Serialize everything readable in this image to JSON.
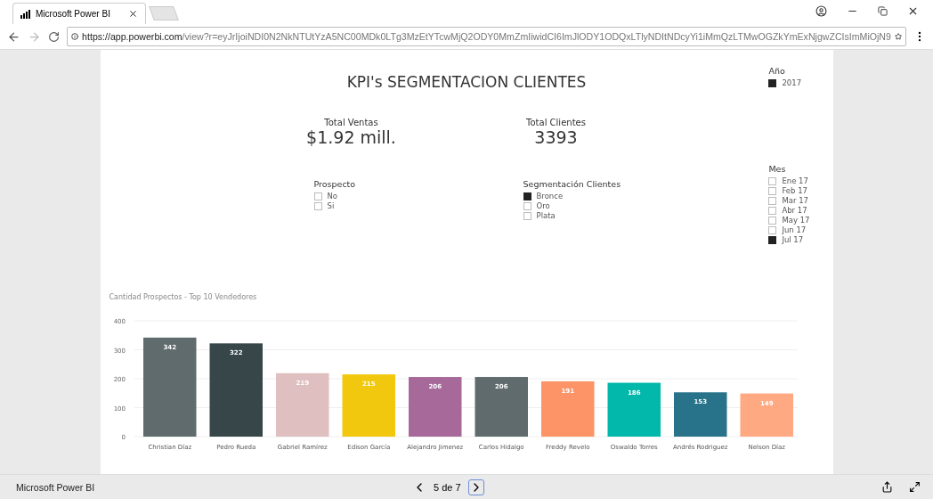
{
  "browser": {
    "tab_title": "Microsoft Power BI",
    "url_host": "https://app.powerbi.com",
    "url_path": "/view?r=eyJrIjoiNDI0N2NkNTUtYzA5NC00MDk0LTg3MzEtYTcwMjQ2ODY0MmZmIiwidCI6ImJlODY1ODQxLTlyNDItNDcyYi1iMmQzLTMwOGZkYmExNjgwZCIsImMiOjN9"
  },
  "report": {
    "title": "KPI's SEGMENTACION CLIENTES",
    "kpis": [
      {
        "label": "Total Ventas",
        "value": "$1.92 mill."
      },
      {
        "label": "Total Clientes",
        "value": "3393"
      }
    ],
    "slicers": [
      {
        "title": "Prospecto",
        "items": [
          {
            "label": "No",
            "checked": false
          },
          {
            "label": "Si",
            "checked": false
          }
        ]
      },
      {
        "title": "Segmentación Clientes",
        "items": [
          {
            "label": "Bronce",
            "checked": true
          },
          {
            "label": "Oro",
            "checked": false
          },
          {
            "label": "Plata",
            "checked": false
          }
        ]
      }
    ],
    "year_slicer": {
      "title": "Año",
      "items": [
        {
          "label": "2017",
          "checked": true
        }
      ]
    },
    "month_slicer": {
      "title": "Mes",
      "items": [
        {
          "label": "Ene 17",
          "checked": false
        },
        {
          "label": "Feb 17",
          "checked": false
        },
        {
          "label": "Mar 17",
          "checked": false
        },
        {
          "label": "Abr 17",
          "checked": false
        },
        {
          "label": "May 17",
          "checked": false
        },
        {
          "label": "Jun 17",
          "checked": false
        },
        {
          "label": "Jul 17",
          "checked": true
        }
      ]
    },
    "chart_data": {
      "type": "bar",
      "title": "Cantidad Prospectos - Top 10 Vendedores",
      "categories": [
        "Christian Díaz",
        "Pedro Rueda",
        "Gabriel Ramírez",
        "Edison García",
        "Alejandro Jimenez",
        "Carlos Hidalgo",
        "Freddy Revelo",
        "Oswaldo Torres",
        "Andrés Rodriguez",
        "Nelson Díaz"
      ],
      "series": [
        {
          "color": "#5f6b6d",
          "values": [
            342,
            null,
            null,
            null,
            null,
            null,
            null,
            null,
            null,
            null
          ]
        },
        {
          "color": "#374649",
          "values": [
            null,
            322,
            null,
            null,
            null,
            null,
            null,
            null,
            null,
            null
          ]
        },
        {
          "color": "#dfbfbf",
          "values": [
            null,
            null,
            219,
            null,
            null,
            null,
            null,
            null,
            null,
            null
          ]
        },
        {
          "color": "#f2c80f",
          "values": [
            null,
            null,
            null,
            215,
            null,
            null,
            null,
            null,
            null,
            null
          ]
        },
        {
          "color": "#a66999",
          "values": [
            null,
            null,
            null,
            null,
            206,
            null,
            null,
            null,
            null,
            null
          ]
        },
        {
          "color": "#5f6b6d",
          "values": [
            null,
            null,
            null,
            null,
            null,
            206,
            null,
            null,
            null,
            null
          ]
        },
        {
          "color": "#fd9468",
          "values": [
            null,
            null,
            null,
            null,
            null,
            null,
            191,
            null,
            null,
            null
          ]
        },
        {
          "color": "#01b8aa",
          "values": [
            null,
            null,
            null,
            null,
            null,
            null,
            null,
            186,
            null,
            null
          ]
        },
        {
          "color": "#28738a",
          "values": [
            null,
            null,
            null,
            null,
            null,
            null,
            null,
            null,
            153,
            null
          ]
        },
        {
          "color": "#fea982",
          "values": [
            null,
            null,
            null,
            null,
            null,
            null,
            null,
            null,
            null,
            149
          ]
        }
      ],
      "stacked": true,
      "grid": true,
      "ylim": [
        0,
        400
      ],
      "yticks": [
        0,
        100,
        200,
        300,
        400
      ],
      "data_labels": true
    }
  },
  "footer": {
    "app_name": "Microsoft Power BI",
    "page_current": "5",
    "page_sep": "de",
    "page_total": "7"
  }
}
